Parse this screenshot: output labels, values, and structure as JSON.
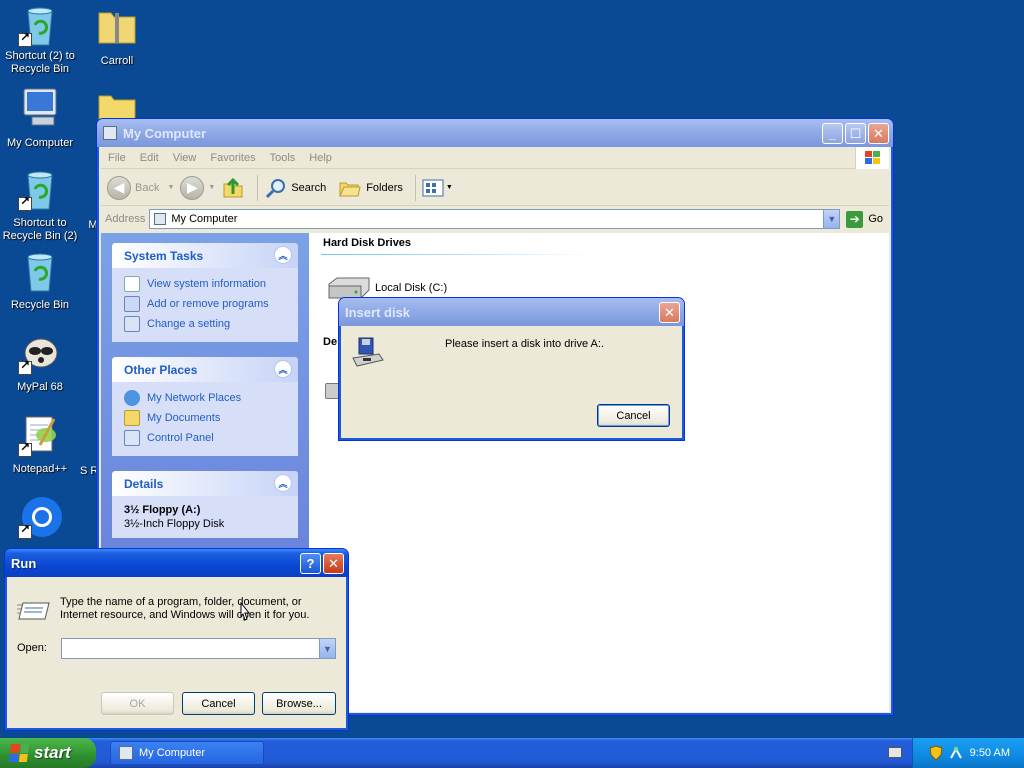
{
  "desktop": {
    "icons": [
      {
        "label": "Shortcut (2) to Recycle Bin"
      },
      {
        "label": "Carroll"
      },
      {
        "label": "My Computer"
      },
      {
        "label": "Shortcut to Recycle Bin (2)"
      },
      {
        "label": "Recycle Bin"
      },
      {
        "label": "MyPal 68"
      },
      {
        "label": "Notepad++"
      },
      {
        "label": "Mi"
      },
      {
        "label": "S R"
      }
    ]
  },
  "mycomputer": {
    "title": "My Computer",
    "menu": [
      "File",
      "Edit",
      "View",
      "Favorites",
      "Tools",
      "Help"
    ],
    "toolbar": {
      "back": "Back",
      "search": "Search",
      "folders": "Folders"
    },
    "address": {
      "label": "Address",
      "value": "My Computer",
      "go": "Go"
    },
    "system_tasks": {
      "title": "System Tasks",
      "items": [
        "View system information",
        "Add or remove programs",
        "Change a setting"
      ]
    },
    "other_places": {
      "title": "Other Places",
      "items": [
        "My Network Places",
        "My Documents",
        "Control Panel"
      ]
    },
    "details": {
      "title": "Details",
      "name": "3½ Floppy (A:)",
      "desc": "3½-Inch Floppy Disk"
    },
    "groups": {
      "hard_disk": "Hard Disk Drives",
      "devices_partial": "De"
    },
    "drives": {
      "local_c": "Local Disk (C:)"
    }
  },
  "insert_disk": {
    "title": "Insert disk",
    "message": "Please insert a disk into drive A:.",
    "cancel": "Cancel"
  },
  "run": {
    "title": "Run",
    "description": "Type the name of a program, folder, document, or Internet resource, and Windows will open it for you.",
    "open_label": "Open:",
    "open_value": "",
    "ok": "OK",
    "cancel": "Cancel",
    "browse": "Browse..."
  },
  "taskbar": {
    "start": "start",
    "task": "My Computer",
    "clock": "9:50 AM"
  },
  "icons": [
    "recycle-bin-icon",
    "folder-icon",
    "computer-icon",
    "raccoon-icon",
    "notepad-icon",
    "browser-icon",
    "floppy-icon",
    "hard-disk-icon",
    "run-icon",
    "shield-icon"
  ]
}
